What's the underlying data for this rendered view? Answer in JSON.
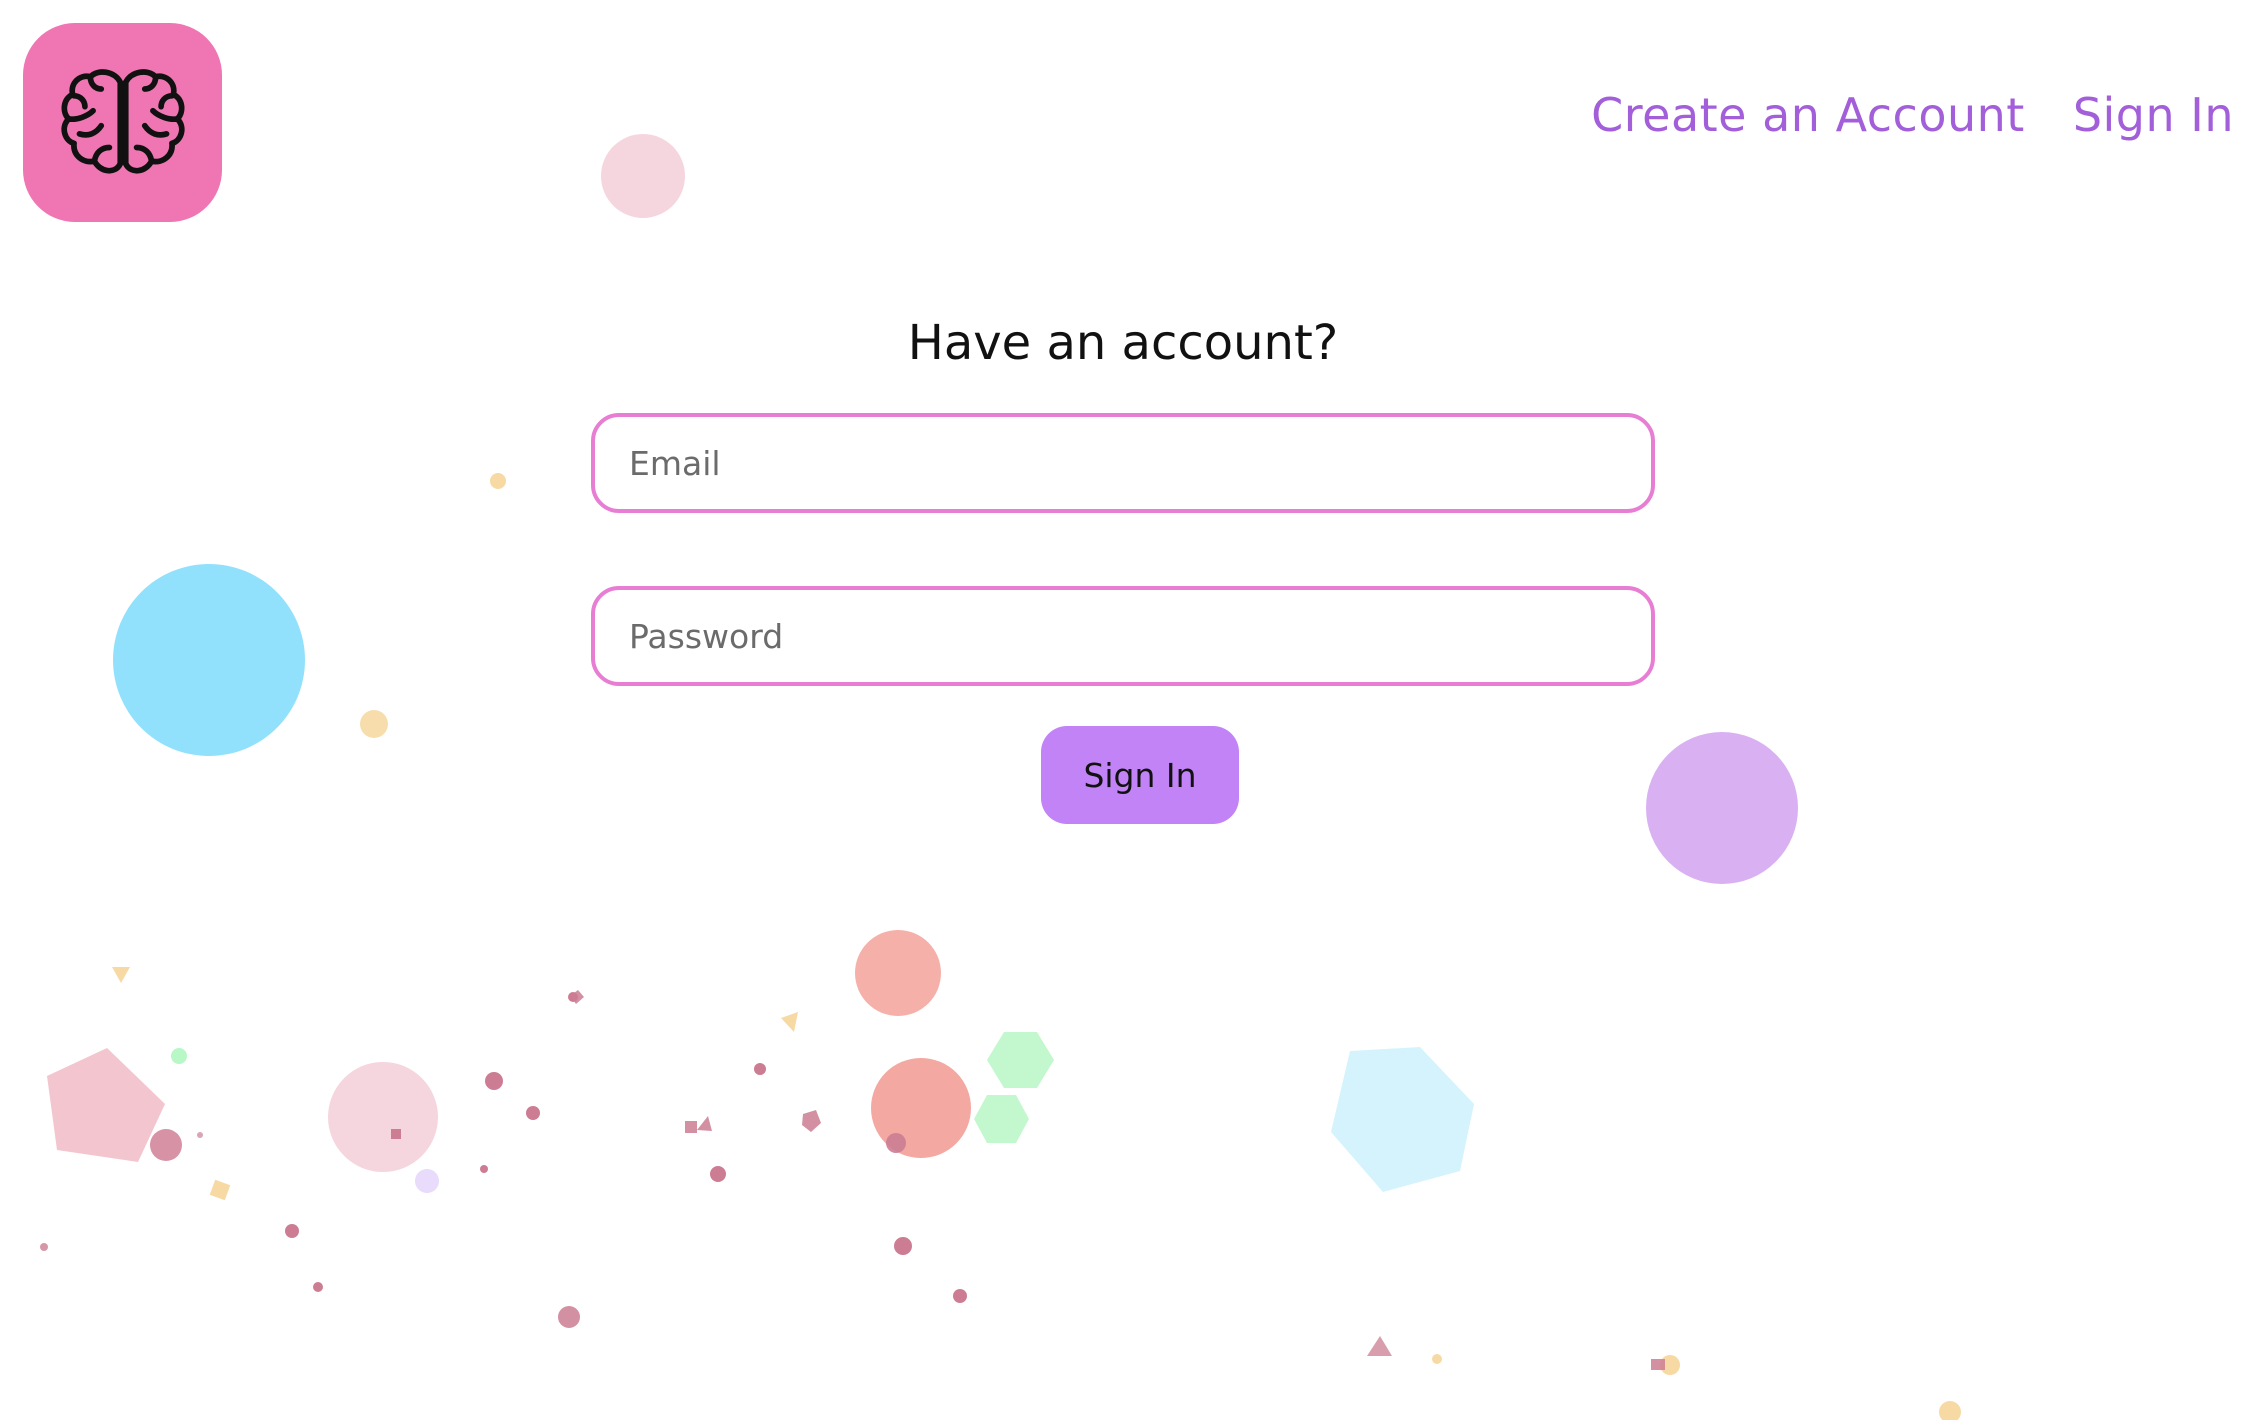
{
  "header": {
    "logo_icon": "brain-icon",
    "nav": {
      "create_account_label": "Create an Account",
      "sign_in_label": "Sign In"
    }
  },
  "form": {
    "title": "Have an account?",
    "email_placeholder": "Email",
    "password_placeholder": "Password",
    "submit_label": "Sign In"
  },
  "colors": {
    "brand_pink": "#ef76b2",
    "nav_purple": "#a35fd9",
    "field_border": "#e87dd4",
    "button_purple": "#c283f6"
  }
}
